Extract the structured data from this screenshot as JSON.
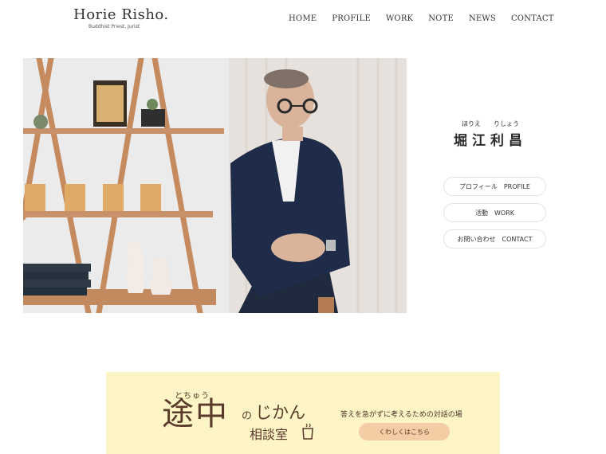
{
  "header": {
    "logo_title": "Horie Risho.",
    "logo_subtitle": "Buddhist Priest, Jurist",
    "nav": [
      "HOME",
      "PROFILE",
      "WORK",
      "NOTE",
      "NEWS",
      "CONTACT"
    ]
  },
  "profile": {
    "ruby_given_family": "ほりえ",
    "ruby_given_name": "りしょう",
    "name": "堀江利昌"
  },
  "buttons": {
    "profile": "プロフィール　PROFILE",
    "work": "活動　WORK",
    "contact": "お問い合わせ　CONTACT"
  },
  "banner": {
    "ruby": "とちゅう",
    "big": "途中",
    "no": "の",
    "jikan": "じかん",
    "sodan": "相談室",
    "tagline": "答えを急がずに考えるための対話の場",
    "cta": "くわしくはこちら"
  },
  "colors": {
    "banner_bg": "#fdf5c6",
    "banner_text": "#5a3a2a",
    "cta_bg": "#f4cda4"
  }
}
